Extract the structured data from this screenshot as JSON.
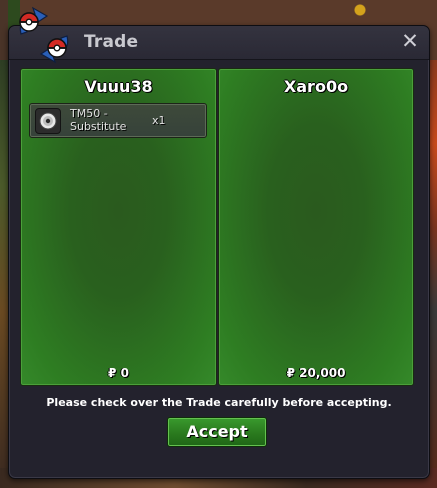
{
  "window": {
    "title": "Trade",
    "close_label": "✕"
  },
  "left_panel": {
    "player_name": "Vuuu38",
    "items": [
      {
        "name": "TM50 - Substitute",
        "quantity": "x1",
        "icon": "tm-disc-icon"
      }
    ],
    "money": "₽ 0"
  },
  "right_panel": {
    "player_name": "Xaro0o",
    "items": [],
    "money": "₽ 20,000"
  },
  "notice": "Please check over the Trade carefully before accepting.",
  "accept_button": "Accept",
  "colors": {
    "panel_green": "#2e7d22",
    "dialog_bg": "#23222d",
    "accept_green": "#2a7a1e"
  }
}
